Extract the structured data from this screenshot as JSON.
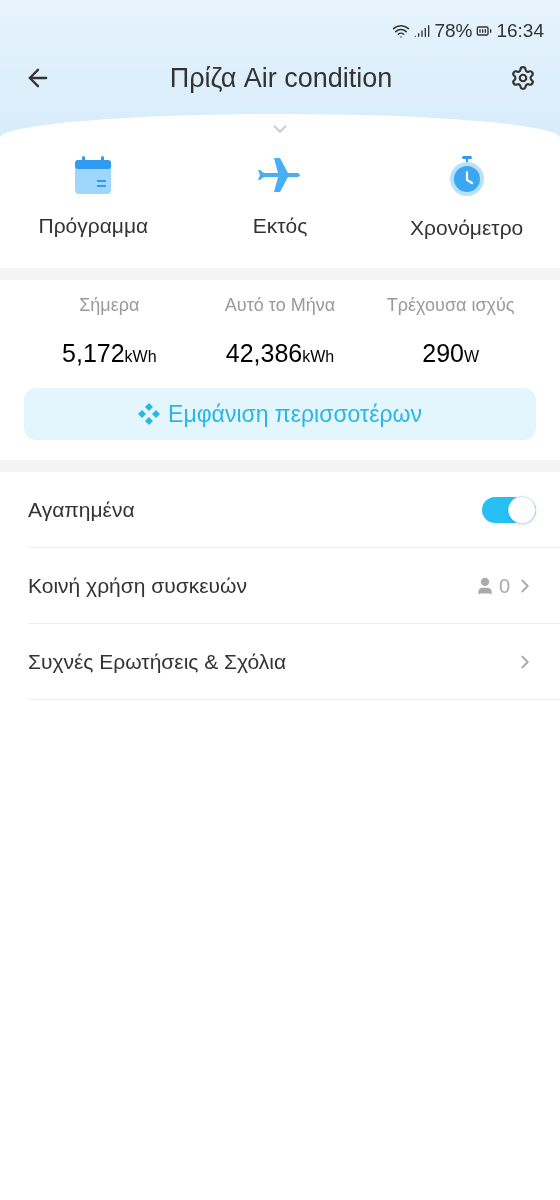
{
  "status_bar": {
    "battery": "78%",
    "time": "16:34"
  },
  "header": {
    "title": "Πρίζα Air condition"
  },
  "quick_actions": [
    {
      "kind": "calendar",
      "label": "Πρόγραμμα"
    },
    {
      "kind": "plane",
      "label": "Εκτός"
    },
    {
      "kind": "timer",
      "label": "Χρονόμετρο"
    }
  ],
  "stats": [
    {
      "label": "Σήμερα",
      "value": "5,172",
      "unit": "kWh"
    },
    {
      "label": "Αυτό το Μήνα",
      "value": "42,386",
      "unit": "kWh"
    },
    {
      "label": "Τρέχουσα ισχύς",
      "value": "290",
      "unit": "W"
    }
  ],
  "show_more_button": {
    "label": "Εμφάνιση περισσοτέρων"
  },
  "settings": [
    {
      "kind": "toggle",
      "label": "Αγαπημένα",
      "on": true
    },
    {
      "kind": "share",
      "label": "Κοινή χρήση συσκευών",
      "count": "0"
    },
    {
      "kind": "link",
      "label": "Συχνές Ερωτήσεις & Σχόλια"
    }
  ]
}
